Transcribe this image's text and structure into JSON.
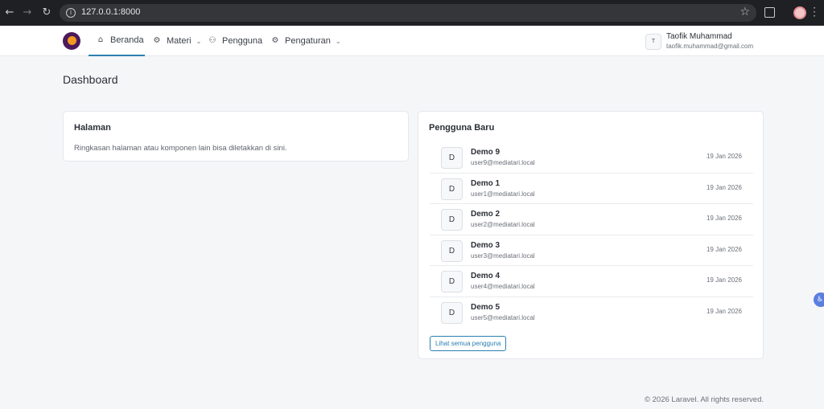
{
  "browser": {
    "url": "127.0.0.1:8000",
    "icons": [
      "back-icon",
      "forward-icon",
      "reload-icon",
      "site-info-icon",
      "bookmark-star-icon",
      "extensions-icon",
      "profile-icon",
      "more-menu-icon"
    ]
  },
  "navbar": {
    "items": [
      {
        "label": "Beranda",
        "icon": "home-icon",
        "active": true
      },
      {
        "label": "Materi",
        "icon": "gear-icon",
        "dropdown": true
      },
      {
        "label": "Pengguna",
        "icon": "users-icon"
      },
      {
        "label": "Pengaturan",
        "icon": "gear-icon",
        "dropdown": true
      }
    ],
    "user": {
      "initial": "T",
      "name": "Taofik Muhammad",
      "email": "taofik.muhammad@gmail.com"
    }
  },
  "main": {
    "page_title": "Dashboard",
    "halaman_card": {
      "title": "Halaman",
      "text": "Ringkasan halaman atau komponen lain bisa diletakkan di sini."
    },
    "users_card": {
      "title": "Pengguna Baru",
      "users": [
        {
          "initial": "D",
          "name": "Demo 9",
          "email": "user9@mediatari.local",
          "date": "19 Jan 2026"
        },
        {
          "initial": "D",
          "name": "Demo 1",
          "email": "user1@mediatari.local",
          "date": "19 Jan 2026"
        },
        {
          "initial": "D",
          "name": "Demo 2",
          "email": "user2@mediatari.local",
          "date": "19 Jan 2026"
        },
        {
          "initial": "D",
          "name": "Demo 3",
          "email": "user3@mediatari.local",
          "date": "19 Jan 2026"
        },
        {
          "initial": "D",
          "name": "Demo 4",
          "email": "user4@mediatari.local",
          "date": "19 Jan 2026"
        },
        {
          "initial": "D",
          "name": "Demo 5",
          "email": "user5@mediatari.local",
          "date": "19 Jan 2026"
        }
      ],
      "view_all_label": "Lihat semua pengguna"
    }
  },
  "footer": {
    "text": "© 2026 Laravel. All rights reserved."
  },
  "colors": {
    "accent": "#2b7fb0",
    "background": "#f5f6f8",
    "chrome": "#1f2023"
  }
}
